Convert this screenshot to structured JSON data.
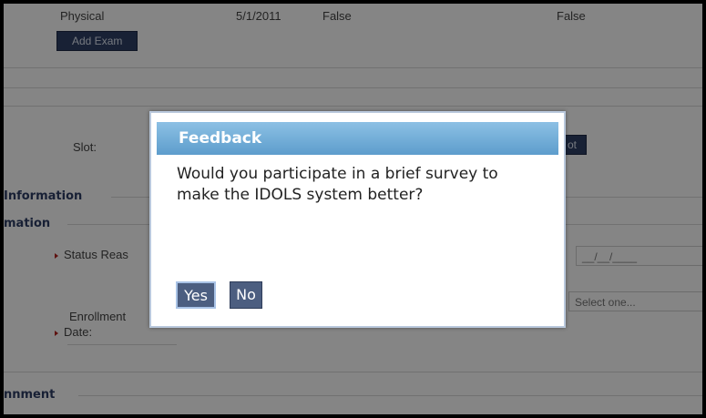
{
  "background": {
    "exam_row": {
      "type": "Physical",
      "date": "5/1/2011",
      "flag1": "False",
      "flag2": "False"
    },
    "add_exam_button": "Add Exam",
    "slot_label": "Slot:",
    "slot_button_fragment": "ot",
    "section_information": "Information",
    "section_mation": "mation",
    "status_reason_label": "Status Reas",
    "date_placeholder": "__/__/____",
    "enrollment_label_line1": "Enrollment",
    "enrollment_label_line2": "Date:",
    "select_placeholder": "Select one...",
    "section_assignment": "nnment"
  },
  "dialog": {
    "title": "Feedback",
    "message": "Would you participate in a brief survey to make the IDOLS system better?",
    "yes_label": "Yes",
    "no_label": "No"
  },
  "colors": {
    "title_bar": "#6aaad6",
    "button": "#4c5e80",
    "dark_button": "#2e4066",
    "required_arrow": "#b5231f"
  }
}
